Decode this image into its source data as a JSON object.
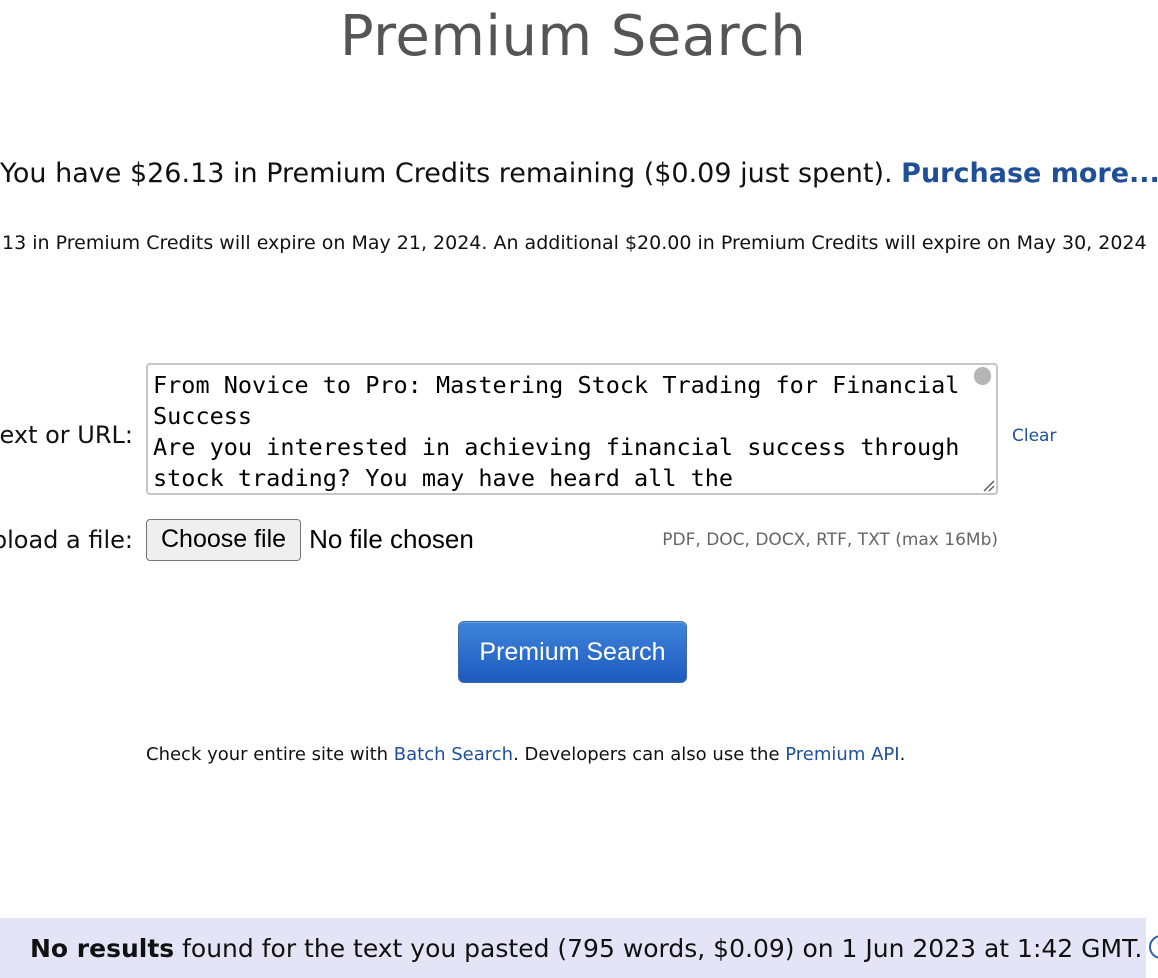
{
  "page_title": "Premium Search",
  "credits": {
    "prefix": "You have $26.13 in Premium Credits remaining ($0.09 just spent). ",
    "purchase_link": "Purchase more...",
    "expiry_text": ".13 in Premium Credits will expire on May 21, 2024. An additional $20.00 in Premium Credits will expire on May 30, 2024"
  },
  "form": {
    "text_label": "ext or URL:",
    "text_value": "From Novice to Pro: Mastering Stock Trading for Financial Success\nAre you interested in achieving financial success through stock trading? You may have heard all the",
    "clear_link": "Clear",
    "file_label": "bload a file:",
    "choose_button": "Choose file",
    "no_file_text": "No file chosen",
    "file_hint": "PDF, DOC, DOCX, RTF, TXT (max 16Mb)",
    "search_button": "Premium Search"
  },
  "info": {
    "part1": "Check your entire site with ",
    "batch_link": "Batch Search",
    "part2": ". Developers can also use the ",
    "api_link": "Premium API",
    "part3": "."
  },
  "results": {
    "bold": "No results",
    "text": " found for the text you pasted (795 words, $0.09) on 1 Jun 2023 at 1:42 GMT."
  },
  "colors": {
    "link": "#1f4f97",
    "button": "#2b6dcf",
    "results_bg": "#e4e4f7"
  }
}
